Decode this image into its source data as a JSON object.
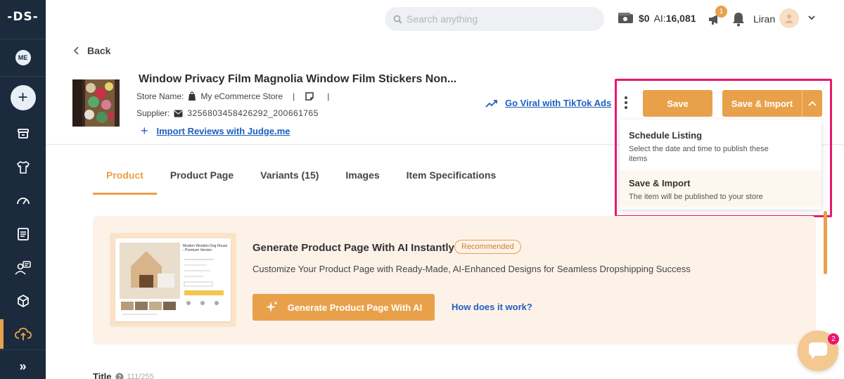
{
  "sidebar": {
    "logo": "-DS-",
    "me_badge": "ME",
    "items": [
      "store-icon",
      "shirt-icon",
      "dashboard-icon",
      "orders-icon",
      "customers-icon",
      "products-icon",
      "import-icon",
      "expand-icon"
    ],
    "active_item": "import-icon"
  },
  "topbar": {
    "search_placeholder": "Search anything",
    "wallet_amount": "$0",
    "ai_label": "AI:",
    "ai_credits": "16,081",
    "notification_count": "1",
    "user_name": "Liran"
  },
  "back_label": "Back",
  "product": {
    "title": "Window Privacy Film Magnolia Window Film Stickers Non...",
    "store_label": "Store Name:",
    "store_name": "My eCommerce Store",
    "separator": "|",
    "supplier_label": "Supplier:",
    "supplier_id": "3256803458426292_200661765",
    "import_reviews": "Import Reviews with Judge.me",
    "tiktok_link": "Go Viral with TikTok Ads"
  },
  "actions": {
    "save": "Save",
    "save_import": "Save & Import",
    "menu": [
      {
        "title": "Schedule Listing",
        "desc": "Select the date and time to publish these items"
      },
      {
        "title": "Save & Import",
        "desc": "The item will be published to your store"
      }
    ]
  },
  "tabs": [
    "Product",
    "Product Page",
    "Variants (15)",
    "Images",
    "Item Specifications"
  ],
  "active_tab": "Product",
  "banner": {
    "title": "Generate Product Page With AI Instantly",
    "badge": "Recommended",
    "subtitle": "Customize Your Product Page with Ready-Made, AI-Enhanced Designs for Seamless Dropshipping Success",
    "button": "Generate Product Page With AI",
    "link": "How does it work?",
    "mock_title": "Modern Wooden Dog House - Premium Version"
  },
  "title_field": {
    "label": "Title",
    "count": "111/255"
  },
  "chat": {
    "badge": "2"
  },
  "colors": {
    "accent": "#e8a14a",
    "highlight": "#e8176e",
    "sidebar": "#1b2a3d",
    "link": "#1f5fbf"
  }
}
